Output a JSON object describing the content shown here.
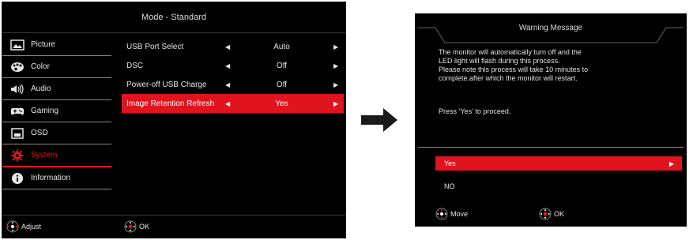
{
  "osd": {
    "title": "Mode - Standard",
    "sidebar": [
      {
        "label": "Picture",
        "icon": "picture-icon"
      },
      {
        "label": "Color",
        "icon": "color-palette-icon"
      },
      {
        "label": "Audio",
        "icon": "speaker-icon"
      },
      {
        "label": "Gaming",
        "icon": "gamepad-icon"
      },
      {
        "label": "OSD",
        "icon": "osd-window-icon"
      },
      {
        "label": "System",
        "icon": "gear-icon"
      },
      {
        "label": "Information",
        "icon": "info-icon"
      }
    ],
    "active_sidebar": "System",
    "settings": [
      {
        "label": "USB Port Select",
        "value": "Auto"
      },
      {
        "label": "DSC",
        "value": "Off"
      },
      {
        "label": "Power-off USB Charge",
        "value": "Off"
      },
      {
        "label": "Image Retention Refresh",
        "value": "Yes"
      }
    ],
    "footer": {
      "adjust": "Adjust",
      "ok": "OK"
    }
  },
  "warning": {
    "title": "Warning Message",
    "message_lines": [
      "The monitor will automatically turn off and the",
      "LED light will flash during this process.",
      "Please note this process will take 10 minutes to",
      "complete.after which the monitor will restart."
    ],
    "prompt": "Press ‘Yes’ to proceed.",
    "options": [
      "Yes",
      "NO"
    ],
    "footer": {
      "move": "Move",
      "ok": "OK"
    }
  },
  "colors": {
    "accent": "#e0141e",
    "panel": "#000000"
  }
}
